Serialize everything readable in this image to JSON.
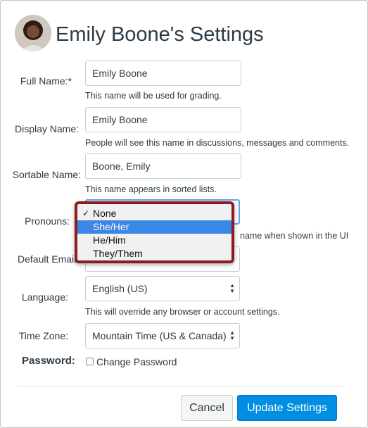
{
  "header": {
    "title": "Emily Boone's Settings"
  },
  "fields": {
    "full_name": {
      "label": "Full Name:*",
      "value": "Emily Boone",
      "hint": "This name will be used for grading."
    },
    "display_name": {
      "label": "Display Name:",
      "value": "Emily Boone",
      "hint": "People will see this name in discussions, messages and comments."
    },
    "sortable_name": {
      "label": "Sortable Name:",
      "value": "Boone, Emily",
      "hint": "This name appears in sorted lists."
    },
    "pronouns": {
      "label": "Pronouns:",
      "hint_visible": "name when shown in the UI",
      "options": [
        "None",
        "She/Her",
        "He/Him",
        "They/Them"
      ],
      "checked": "None",
      "highlighted": "She/Her"
    },
    "default_email": {
      "label": "Default Email"
    },
    "language": {
      "label": "Language:",
      "value": "English (US)",
      "hint": "This will override any browser or account settings."
    },
    "time_zone": {
      "label": "Time Zone:",
      "value": "Mountain Time (US & Canada) (-"
    },
    "password": {
      "label": "Password:",
      "checkbox_label": "Change Password"
    }
  },
  "actions": {
    "cancel_label": "Cancel",
    "update_label": "Update Settings"
  },
  "colors": {
    "primary": "#008ee2",
    "highlight": "#3b87e6",
    "callout_border": "#8b1c23",
    "text": "#2d3b45"
  }
}
